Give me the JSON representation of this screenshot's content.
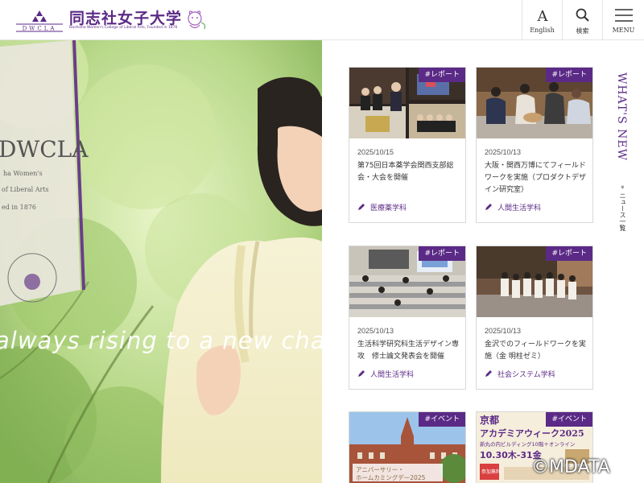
{
  "header": {
    "logo": {
      "name": "同志社女子大学",
      "mark_text": "DWCLA",
      "subtitle": "Doshisha Women's College of Liberal Arts, Founded in 1876"
    },
    "buttons": {
      "language": {
        "label": "English",
        "icon": "letter-a-icon"
      },
      "search": {
        "label": "検索",
        "icon": "search-icon"
      },
      "menu": {
        "label": "MENU",
        "icon": "hamburger-icon"
      }
    }
  },
  "hero": {
    "tagline": "always rising to a new challe",
    "banner_text": "DWCLA",
    "banner_lines": [
      "ha Women's",
      "of Liberal Arts",
      "ed in 1876"
    ]
  },
  "news": {
    "heading": "WHAT'S NEW",
    "list_link": "ニュース一覧",
    "cards": [
      {
        "tag": "#レポート",
        "date": "2025/10/15",
        "title": "第75回日本薬学会関西支部総会・大会を開催",
        "category": "医療薬学科"
      },
      {
        "tag": "#レポート",
        "date": "2025/10/13",
        "title": "大阪・関西万博にてフィールドワークを実施（プロダクトデザイン研究室）",
        "category": "人間生活学科"
      },
      {
        "tag": "#レポート",
        "date": "2025/10/13",
        "title": "生活科学研究科生活デザイン専攻　修士論文発表会を開催",
        "category": "人間生活学科"
      },
      {
        "tag": "#レポート",
        "date": "2025/10/13",
        "title": "金沢でのフィールドワークを実施（金 明柱ゼミ）",
        "category": "社会システム学科"
      },
      {
        "tag": "#イベント",
        "thumb_text": [
          "アニバーサリー・",
          "ホームカミングデー2025"
        ]
      },
      {
        "tag": "#イベント",
        "thumb_text": [
          "京都",
          "アカデミアウィーク2025",
          "新丸の内ビルディング10階＋オンライン",
          "10.30木-31金",
          "参加無料"
        ]
      }
    ]
  },
  "copyright": "©MDATA",
  "colors": {
    "brand": "#5b2a86",
    "border": "#d8d8d8"
  }
}
